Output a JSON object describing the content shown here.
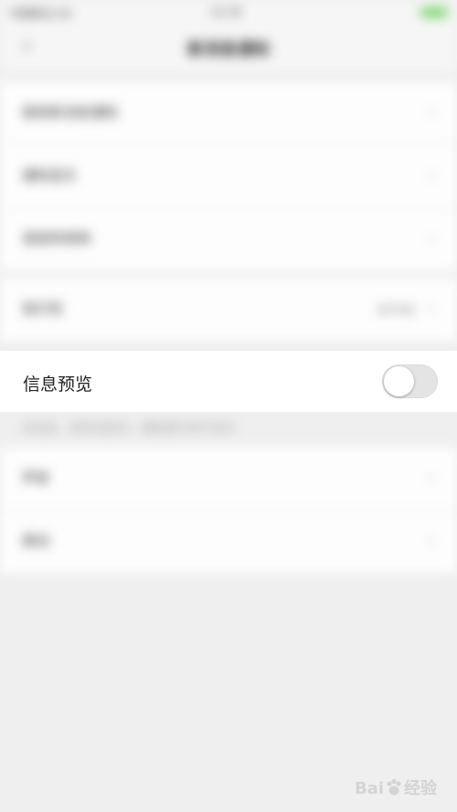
{
  "background": {
    "status_bar": {
      "time": "中国移动 4G",
      "center": "10:30",
      "battery_color": "#6bd45f"
    },
    "nav_bar": {
      "back_glyph": "‹",
      "title": "新消息通知"
    },
    "group1": [
      {
        "label": "接收新消息通知",
        "chevron": "›"
      },
      {
        "label": "通知显示",
        "chevron": "›"
      },
      {
        "label": "语音和视频",
        "chevron": "›"
      }
    ],
    "group2": [
      {
        "label": "免打扰",
        "value": "未开启",
        "chevron": "›"
      }
    ],
    "footnote": "关闭后，收到消息时，通知提示将不显示",
    "group3": [
      {
        "label": "声音",
        "chevron": "›"
      },
      {
        "label": "振动",
        "chevron": "›"
      }
    ]
  },
  "focus": {
    "label": "信息预览",
    "toggle_state": "off"
  },
  "colors": {
    "page_bg": "#efefef",
    "toggle_off": "#e4e4e4"
  },
  "watermark": {
    "text": "Bai",
    "text2": "经验"
  }
}
